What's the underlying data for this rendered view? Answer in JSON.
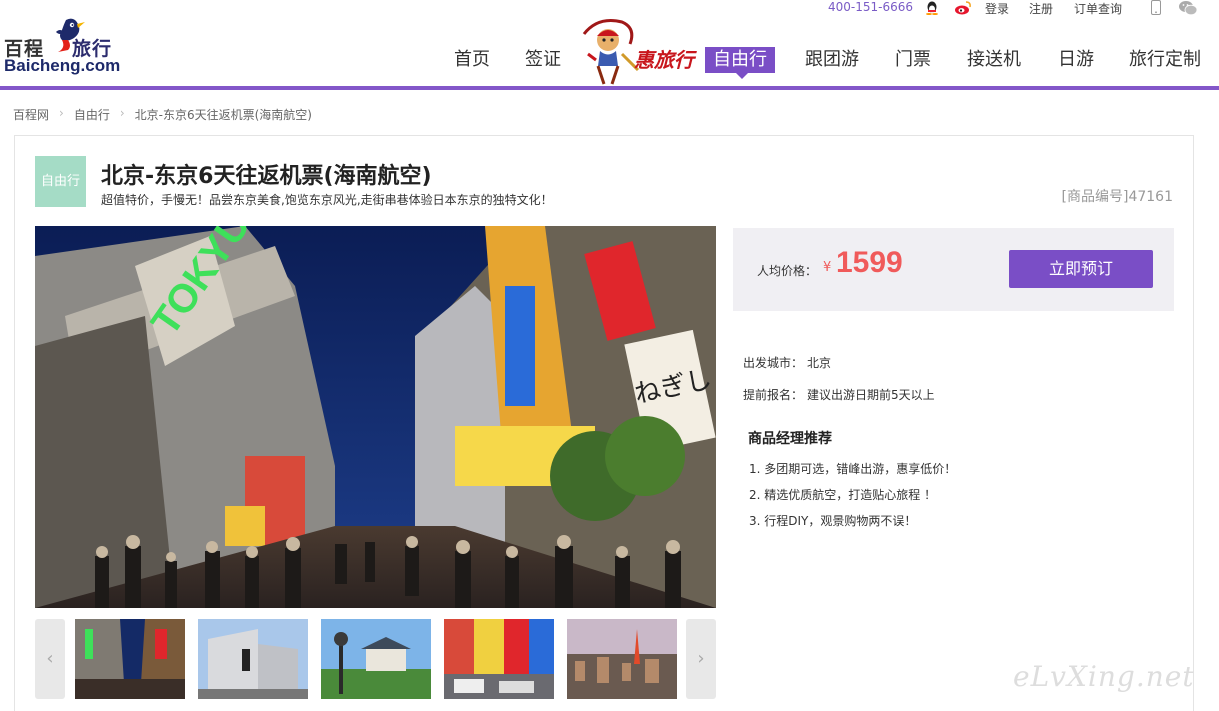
{
  "topbar": {
    "phone": "400-151-6666",
    "login": "登录",
    "register": "注册",
    "order_query": "订单查询"
  },
  "logo": {
    "cn_part1": "百程",
    "cn_part2": "旅行",
    "en": "Baicheng.com"
  },
  "promo": {
    "text": "惠旅行"
  },
  "nav": {
    "items": [
      {
        "label": "首页"
      },
      {
        "label": "签证"
      },
      {
        "label": "自由行",
        "active": true
      },
      {
        "label": "跟团游"
      },
      {
        "label": "门票"
      },
      {
        "label": "接送机"
      },
      {
        "label": "日游"
      },
      {
        "label": "旅行定制"
      }
    ]
  },
  "breadcrumb": {
    "items": [
      "百程网",
      "自由行",
      "北京-东京6天往返机票(海南航空)"
    ]
  },
  "product": {
    "tag": "自由行",
    "title": "北京-东京6天往返机票(海南航空)",
    "subtitle": "超值特价，手慢无！品尝东京美食,饱览东京风光,走街串巷体验日本东京的独特文化！",
    "product_no": "[商品编号]47161"
  },
  "price": {
    "label": "人均价格：",
    "currency": "¥",
    "value": "1599",
    "book_label": "立即预订"
  },
  "info": {
    "depart_key": "出发城市：",
    "depart_val": "北京",
    "advance_key": "提前报名：",
    "advance_val": "建议出游日期前5天以上"
  },
  "recommend": {
    "title": "商品经理推荐",
    "items": [
      "1.  多团期可选，错峰出游，惠享低价！",
      "2.  精选优质航空，打造贴心旅程 ！",
      "3.  行程DIY，观景购物两不误！"
    ]
  },
  "watermark": "eLvXing.net",
  "colors": {
    "brand_purple": "#7a4ec6",
    "price_red": "#f05a5a",
    "tag_green": "#a5dcc6"
  }
}
